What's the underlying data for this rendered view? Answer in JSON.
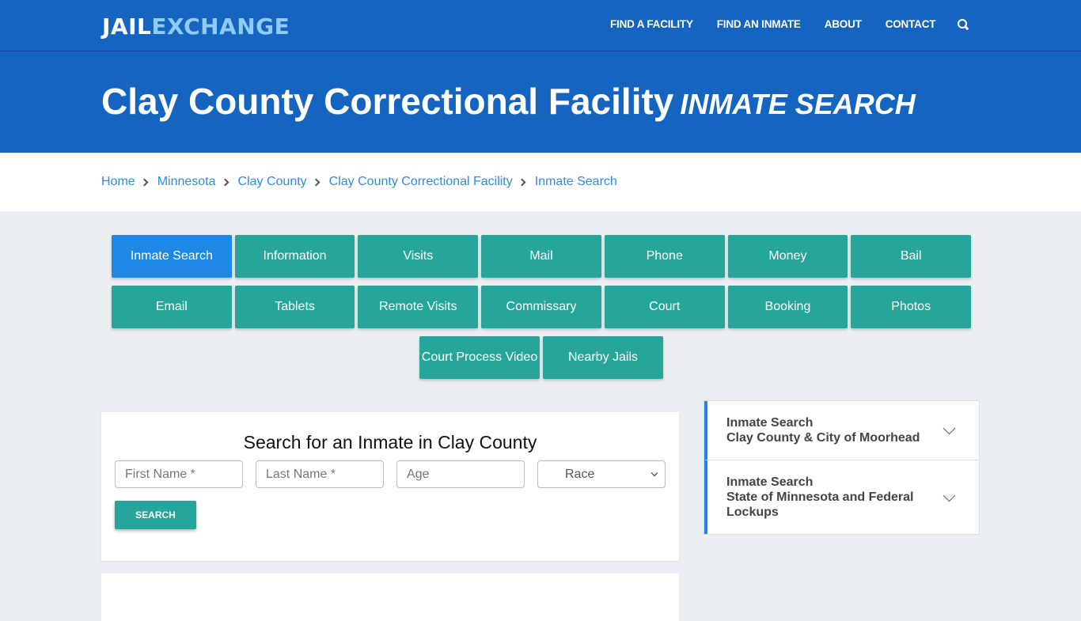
{
  "header": {
    "logo_part1": "JAIL",
    "logo_part2": "EXCHANGE",
    "nav": [
      "FIND A FACILITY",
      "FIND AN INMATE",
      "ABOUT",
      "CONTACT"
    ],
    "search_icon": "search-icon"
  },
  "hero": {
    "title": "Clay County Correctional Facility",
    "subtitle": "INMATE SEARCH"
  },
  "breadcrumb": [
    "Home",
    "Minnesota",
    "Clay County",
    "Clay County Correctional Facility",
    "Inmate Search"
  ],
  "tabs": {
    "row1": [
      "Inmate Search",
      "Information",
      "Visits",
      "Mail",
      "Phone",
      "Money",
      "Bail"
    ],
    "row2": [
      "Email",
      "Tablets",
      "Remote Visits",
      "Commissary",
      "Court",
      "Booking",
      "Photos"
    ],
    "row3": [
      "Court Process Video",
      "Nearby Jails"
    ],
    "active": "Inmate Search"
  },
  "search": {
    "title": "Search for an Inmate in Clay County",
    "first_placeholder": "First Name *",
    "last_placeholder": "Last Name *",
    "age_placeholder": "Age",
    "race_selected": "Race",
    "button": "SEARCH"
  },
  "sidebar": [
    {
      "line1": "Inmate Search",
      "line2": "Clay County & City of Moorhead"
    },
    {
      "line1": "Inmate Search",
      "line2": "State of Minnesota and Federal Lockups"
    }
  ]
}
